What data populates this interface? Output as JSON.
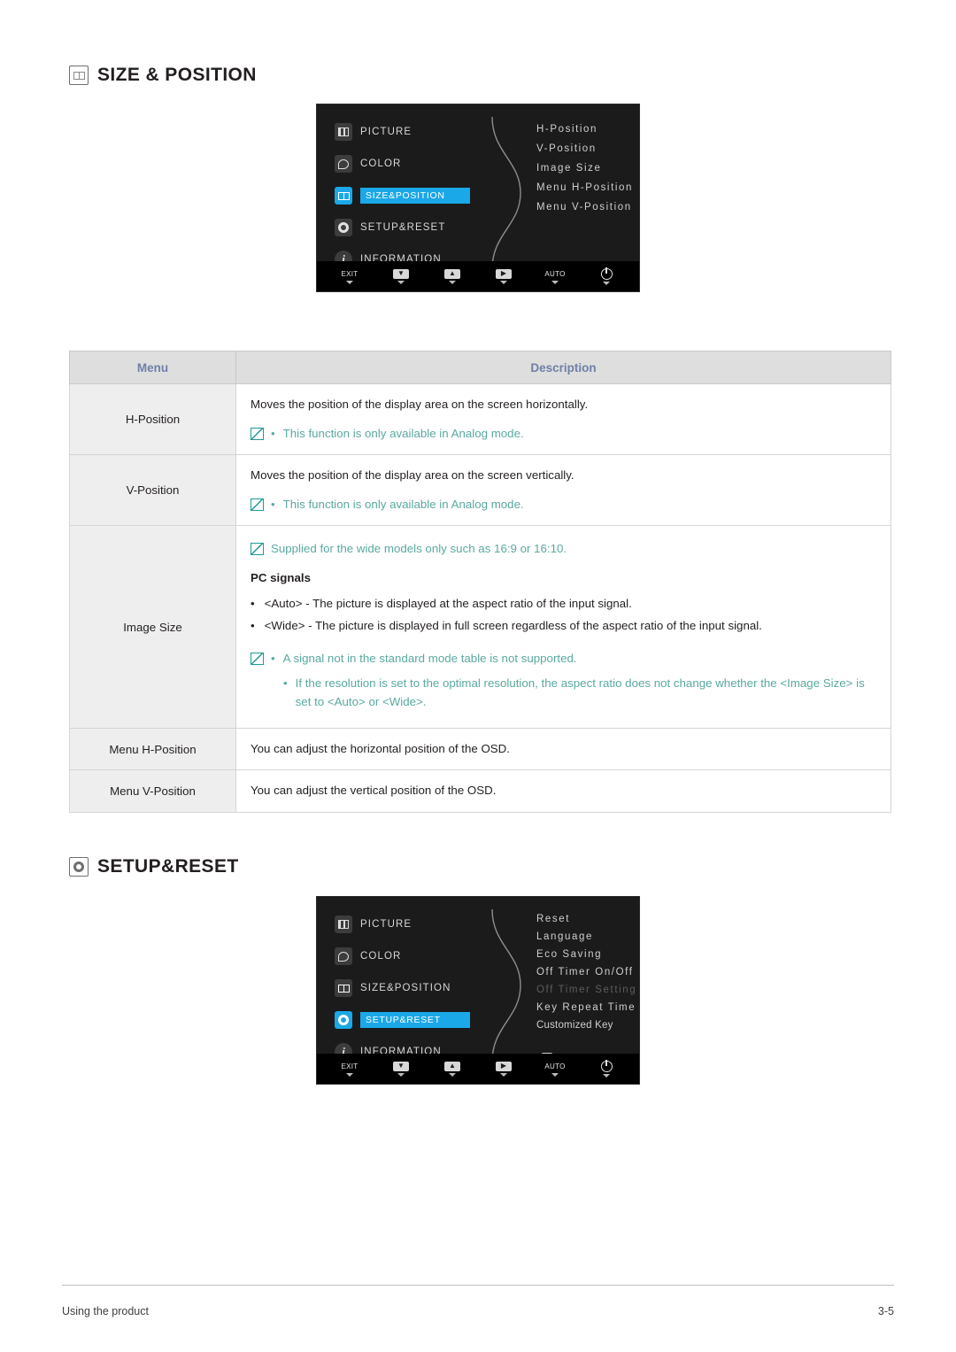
{
  "sections": [
    {
      "id": "size_position",
      "heading": "SIZE & POSITION",
      "icon": "size-position-icon"
    },
    {
      "id": "setup_reset",
      "heading": "SETUP&RESET",
      "icon": "setup-reset-icon"
    }
  ],
  "osd1": {
    "left_items": [
      {
        "label": "PICTURE",
        "icon": "picture-icon",
        "selected": false
      },
      {
        "label": "COLOR",
        "icon": "color-icon",
        "selected": false
      },
      {
        "label": "SIZE&POSITION",
        "icon": "size-position-icon",
        "selected": true
      },
      {
        "label": "SETUP&RESET",
        "icon": "setup-reset-icon",
        "selected": false
      },
      {
        "label": "INFORMATION",
        "icon": "information-icon",
        "selected": false
      }
    ],
    "right_items": [
      {
        "label": "H-Position",
        "dim": false
      },
      {
        "label": "V-Position",
        "dim": false
      },
      {
        "label": "Image Size",
        "dim": false
      },
      {
        "label": "Menu H-Position",
        "dim": false
      },
      {
        "label": "Menu V-Position",
        "dim": false
      }
    ],
    "keys": [
      {
        "label": "EXIT",
        "glyph": ""
      },
      {
        "label": "",
        "glyph": "▼"
      },
      {
        "label": "",
        "glyph": "▲"
      },
      {
        "label": "",
        "glyph": "▶"
      },
      {
        "label": "AUTO",
        "glyph": ""
      },
      {
        "label": "",
        "glyph": "power"
      }
    ]
  },
  "osd2": {
    "left_items": [
      {
        "label": "PICTURE",
        "icon": "picture-icon",
        "selected": false
      },
      {
        "label": "COLOR",
        "icon": "color-icon",
        "selected": false
      },
      {
        "label": "SIZE&POSITION",
        "icon": "size-position-icon",
        "selected": false
      },
      {
        "label": "SETUP&RESET",
        "icon": "setup-reset-icon",
        "selected": true
      },
      {
        "label": "INFORMATION",
        "icon": "information-icon",
        "selected": false
      }
    ],
    "right_items": [
      {
        "label": "Reset",
        "dim": false
      },
      {
        "label": "Language",
        "dim": false
      },
      {
        "label": "Eco Saving",
        "dim": false
      },
      {
        "label": "Off Timer On/Off",
        "dim": false
      },
      {
        "label": "Off Timer Setting",
        "dim": true
      },
      {
        "label": "Key Repeat Time",
        "dim": false
      },
      {
        "label": "Customized Key",
        "dim": false
      }
    ],
    "keys": [
      {
        "label": "EXIT",
        "glyph": ""
      },
      {
        "label": "",
        "glyph": "▼"
      },
      {
        "label": "",
        "glyph": "▲"
      },
      {
        "label": "",
        "glyph": "▶"
      },
      {
        "label": "AUTO",
        "glyph": ""
      },
      {
        "label": "",
        "glyph": "power"
      }
    ]
  },
  "table": {
    "headers": {
      "menu": "Menu",
      "description": "Description"
    },
    "rows": [
      {
        "menu": "H-Position",
        "main": "Moves the position of the display area on the screen horizontally.",
        "note_bullets": [
          "This function is only available in Analog mode."
        ]
      },
      {
        "menu": "V-Position",
        "main": "Moves the position of the display area on the screen vertically.",
        "note_bullets": [
          "This function is only available in Analog mode."
        ]
      },
      {
        "menu": "Image Size",
        "top_note": "Supplied for the wide models only such as 16:9 or 16:10.",
        "sub_title": "PC signals",
        "bullets": [
          "<Auto> - The picture is displayed at the aspect ratio of the input signal.",
          "<Wide> - The picture is displayed in full screen regardless of the aspect ratio of the input signal."
        ],
        "note_bullets": [
          "A signal not in the standard mode table is not supported.",
          "If the resolution is set to the optimal resolution, the aspect ratio does not change whether the <Image Size> is set to <Auto> or <Wide>."
        ]
      },
      {
        "menu": "Menu H-Position",
        "main": "You can adjust the horizontal position of the OSD."
      },
      {
        "menu": "Menu V-Position",
        "main": "You can adjust the vertical position of the OSD."
      }
    ]
  },
  "footer": {
    "left": "Using the product",
    "right": "3-5"
  },
  "colors": {
    "accent_blue": "#1aa8e8",
    "note_teal": "#5aa9a0",
    "header_text": "#6f7fa8",
    "header_bg": "#dedede",
    "menu_bg": "#eeeeee"
  }
}
